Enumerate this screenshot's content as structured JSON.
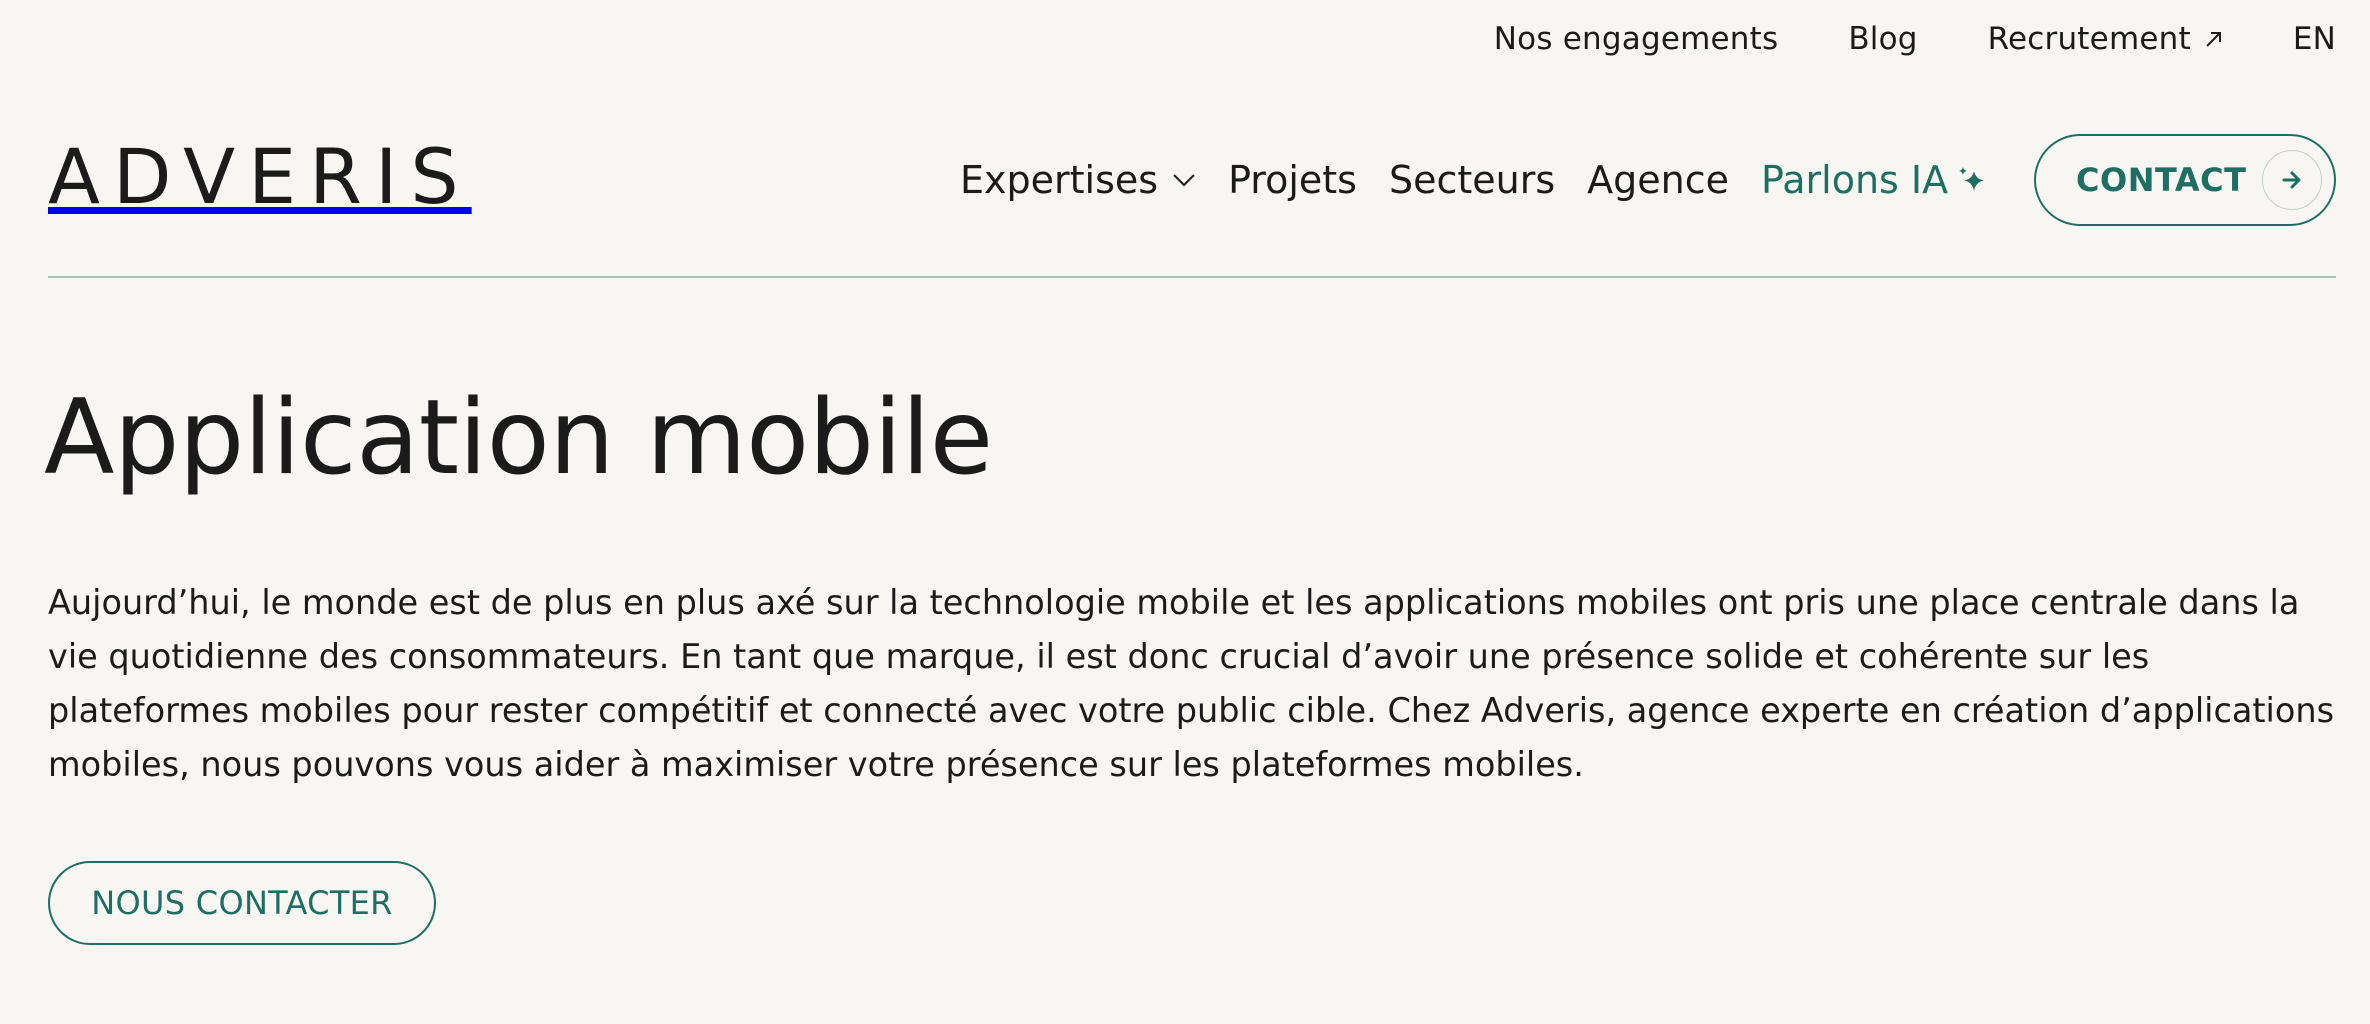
{
  "topbar": {
    "items": [
      {
        "label": "Nos engagements"
      },
      {
        "label": "Blog"
      },
      {
        "label": "Recrutement"
      },
      {
        "label": "EN"
      }
    ]
  },
  "logo": {
    "text": "ADVERIS"
  },
  "nav": {
    "items": [
      {
        "label": "Expertises",
        "icon": "chevron-down-icon"
      },
      {
        "label": "Projets"
      },
      {
        "label": "Secteurs"
      },
      {
        "label": "Agence"
      },
      {
        "label": "Parlons IA",
        "icon": "sparkle-icon"
      }
    ],
    "contact_label": "CONTACT"
  },
  "hero": {
    "title": "Application mobile",
    "text": "Aujourd’hui, le monde est de plus en plus axé sur la technologie mobile et les applications mobiles ont pris une place centrale dans la vie quotidienne des consommateurs. En tant que marque, il est donc crucial d’avoir une présence solide et cohérente sur les plateformes mobiles pour rester compétitif et connecté avec votre public cible. Chez Adveris, agence experte en création d’applications mobiles, nous pouvons vous aider à maximiser votre présence sur les plateformes mobiles.",
    "cta_label": "NOUS CONTACTER"
  },
  "colors": {
    "background": "#f7f6f3",
    "text": "#1b1b1b",
    "accent": "#1f6e63",
    "divider": "#a9c3bc"
  }
}
